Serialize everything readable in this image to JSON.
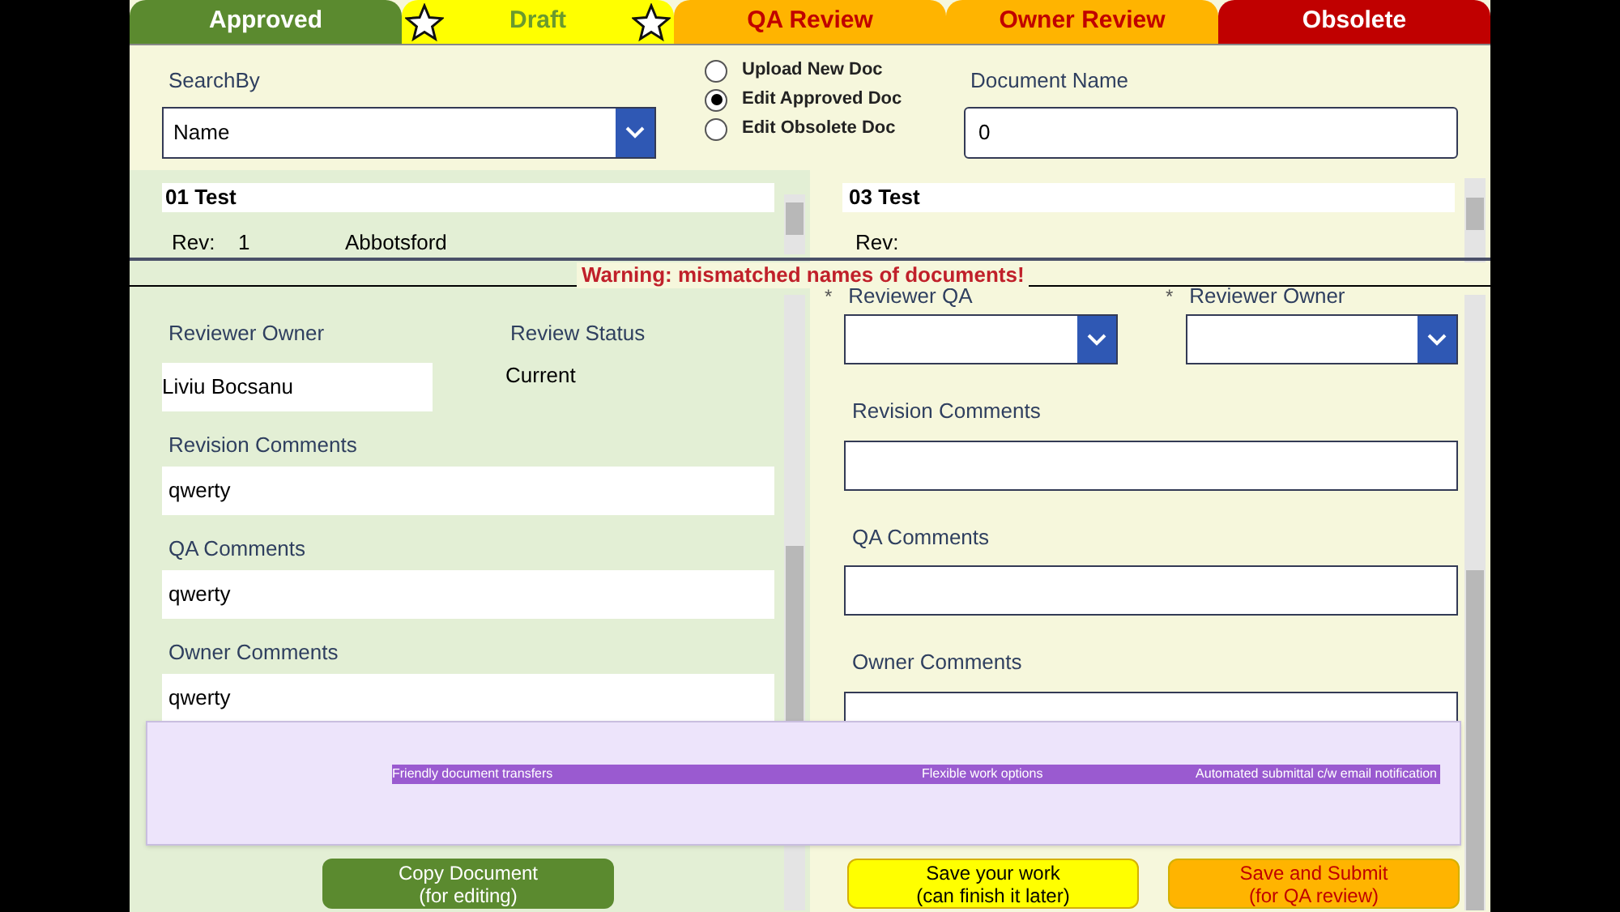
{
  "tabs": [
    {
      "label": "Approved",
      "color": "#5b8a2f",
      "starred": false
    },
    {
      "label": "Draft",
      "color": "#ffff00",
      "starred": true
    },
    {
      "label": "QA Review",
      "color": "#ffb400",
      "starred": false
    },
    {
      "label": "Owner Review",
      "color": "#ffb400",
      "starred": false
    },
    {
      "label": "Obsolete",
      "color": "#c00000",
      "starred": false
    }
  ],
  "search": {
    "label": "SearchBy",
    "value": "Name"
  },
  "modes": [
    {
      "label": "Upload New Doc",
      "selected": false
    },
    {
      "label": "Edit Approved Doc",
      "selected": true
    },
    {
      "label": "Edit Obsolete Doc",
      "selected": false
    }
  ],
  "document_name": {
    "label": "Document Name",
    "value": "0"
  },
  "left_panel": {
    "title": "01 Test",
    "rev_label": "Rev:",
    "rev": "1",
    "location": "Abbotsford",
    "reviewer_owner": {
      "label": "Reviewer Owner",
      "value": "Liviu Bocsanu"
    },
    "review_status": {
      "label": "Review Status",
      "value": "Current"
    },
    "comments": [
      {
        "label": "Revision Comments",
        "value": "qwerty"
      },
      {
        "label": "QA Comments",
        "value": "qwerty"
      },
      {
        "label": "Owner Comments",
        "value": "qwerty"
      }
    ],
    "button": [
      "Copy Document",
      "(for editing)"
    ]
  },
  "right_panel": {
    "title": "03 Test",
    "rev_label": "Rev:",
    "dropdowns": [
      {
        "mark": "*",
        "label": "Reviewer QA"
      },
      {
        "mark": "*",
        "label": "Reviewer Owner"
      }
    ],
    "comments": [
      {
        "label": "Revision Comments"
      },
      {
        "label": "QA Comments"
      },
      {
        "label": "Owner Comments"
      }
    ],
    "buttons": [
      {
        "kind": "save",
        "lines": [
          "Save your work",
          "(can finish it later)"
        ]
      },
      {
        "kind": "submit",
        "lines": [
          "Save and Submit",
          "(for QA review)"
        ]
      }
    ]
  },
  "warning": "Warning: mismatched names of documents!",
  "banner": [
    "Friendly document transfers",
    "Flexible work options",
    "Automated submittal c/w email notification"
  ]
}
